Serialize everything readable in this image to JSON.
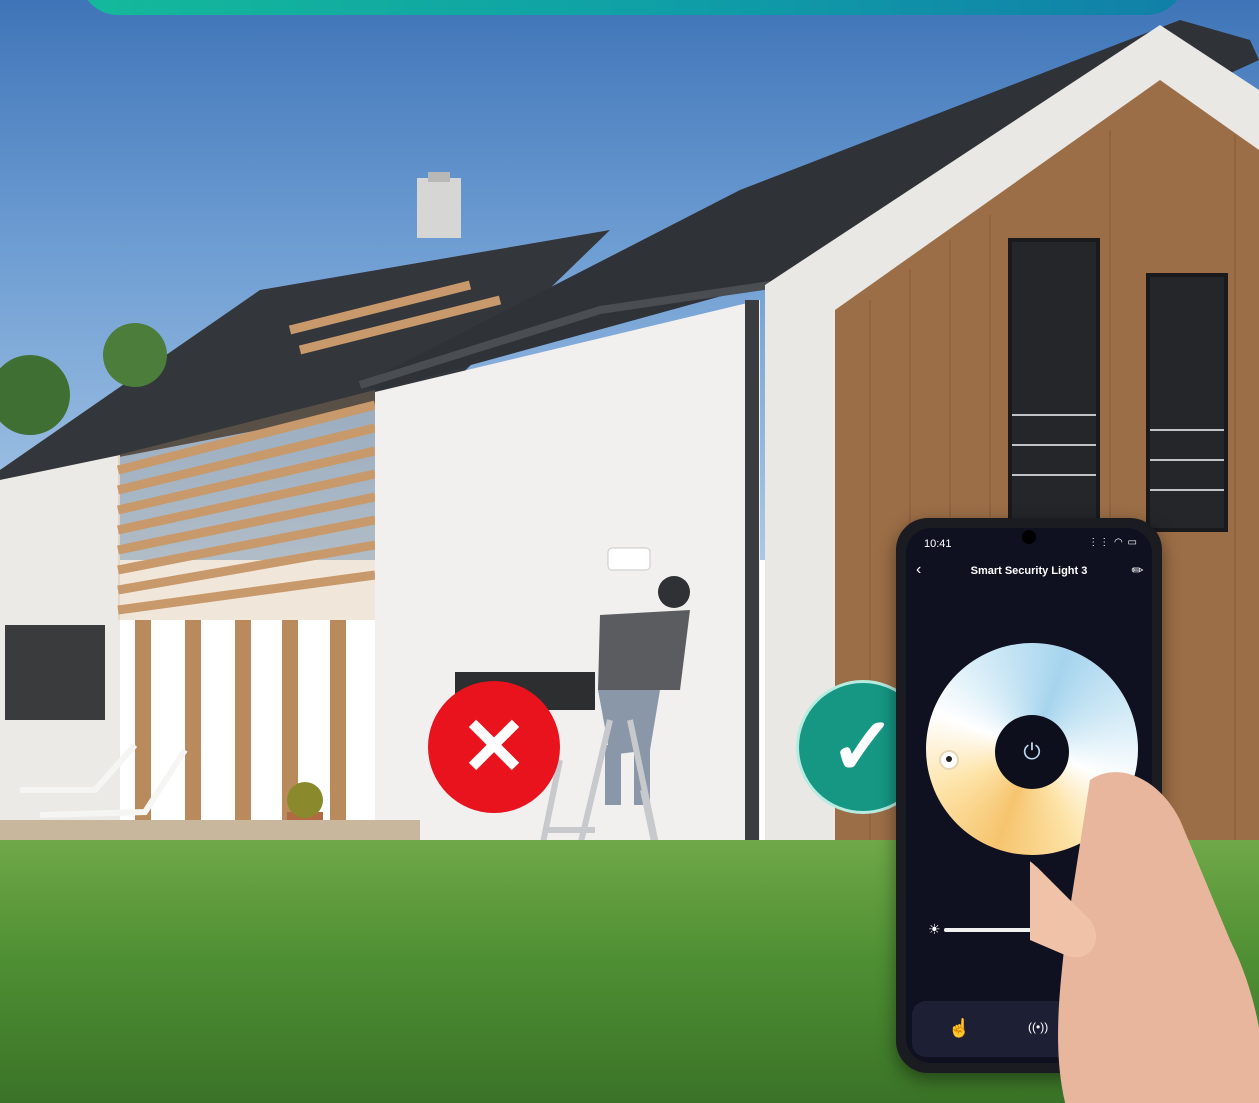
{
  "phone": {
    "status_time": "10:41",
    "status_icons": "⋮⋮ ◠ ▭",
    "app_title": "Smart Security Light 3",
    "back_icon": "‹",
    "edit_icon": "✎",
    "power_icon": "⏻",
    "brightness_icon": "☀",
    "brightness_level": 0.5,
    "tab_manual_icon": "☝",
    "tab_sensor_icon": "((•))"
  },
  "markers": {
    "wrong_icon": "✕",
    "right_icon": "✓"
  },
  "colors": {
    "banner": "#14b99a",
    "wrong": "#e8131d",
    "right": "#169784",
    "tab_active": "#2f7ef7"
  }
}
